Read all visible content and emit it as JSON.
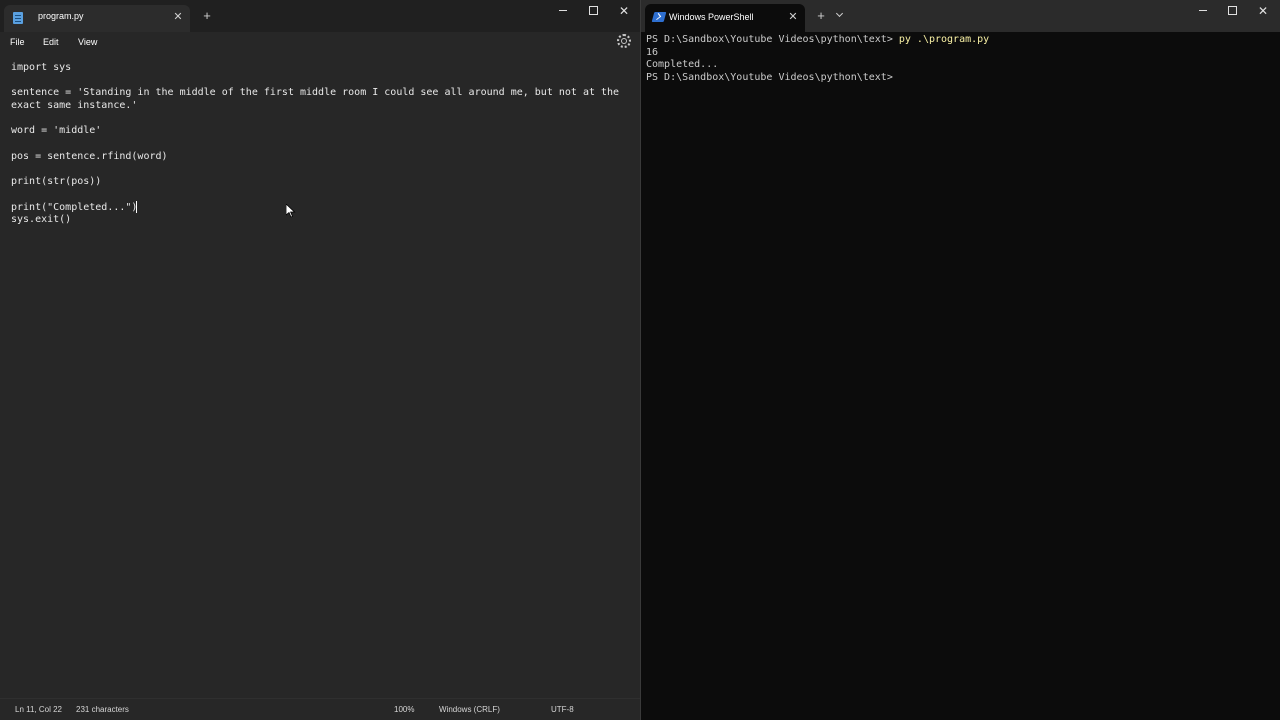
{
  "notepad": {
    "tab_title": "program.py",
    "tab_icon": "notepad-file-icon",
    "new_tab_label": "+",
    "close_label": "✕",
    "menu": [
      "File",
      "Edit",
      "View"
    ],
    "settings_icon": "gear-icon",
    "code_lines": [
      "import sys",
      "",
      "sentence = 'Standing in the middle of the first middle room I could see all around me, but not at the",
      "exact same instance.'",
      "",
      "word = 'middle'",
      "",
      "pos = sentence.rfind(word)",
      "",
      "print(str(pos))",
      "",
      "print(\"Completed...\")",
      "sys.exit()"
    ],
    "status": {
      "position": "Ln 11, Col 22",
      "characters": "231 characters",
      "zoom": "100%",
      "line_ending": "Windows (CRLF)",
      "encoding": "UTF-8"
    }
  },
  "terminal": {
    "tab_title": "Windows PowerShell",
    "tab_icon": "powershell-icon",
    "new_tab_label": "+",
    "close_label": "✕",
    "prompt_1": "PS D:\\Sandbox\\Youtube Videos\\python\\text> ",
    "command_1": "py .\\program.py",
    "output_1": "16",
    "output_2": "Completed...",
    "prompt_2": "PS D:\\Sandbox\\Youtube Videos\\python\\text>"
  },
  "colors": {
    "editor_bg": "#272727",
    "terminal_bg": "#0c0c0c",
    "command_highlight": "#f9f1a5",
    "accent_icon": "#2e6fd0"
  }
}
